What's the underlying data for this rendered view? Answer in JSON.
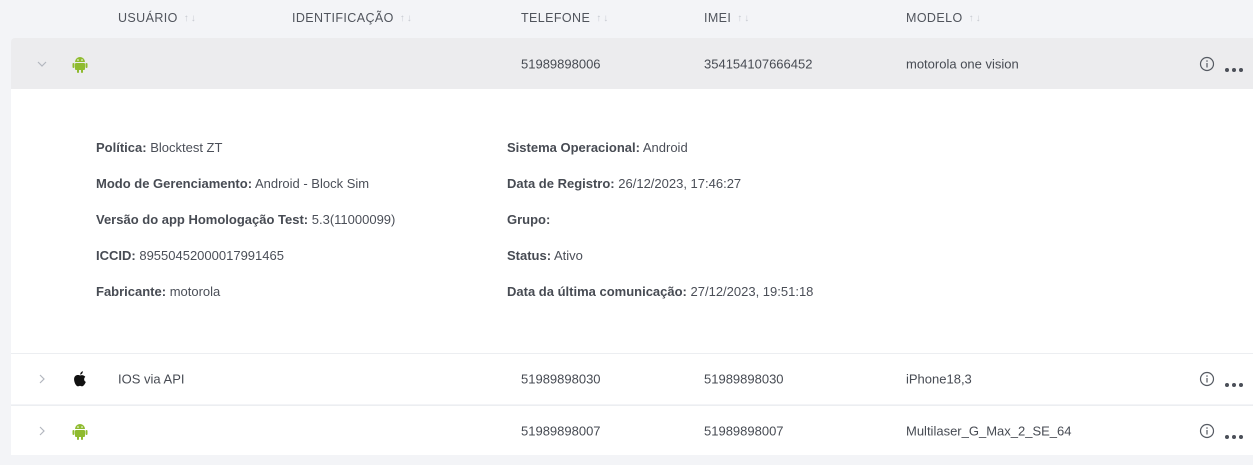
{
  "columns": [
    {
      "label": "USUÁRIO"
    },
    {
      "label": "IDENTIFICAÇÃO"
    },
    {
      "label": "TELEFONE"
    },
    {
      "label": "IMEI"
    },
    {
      "label": "MODELO"
    }
  ],
  "sort_arrows": "↑↓",
  "colors": {
    "android_green": "#8fbb2f",
    "apple_black": "#111111",
    "icon_grey": "#6c7078"
  },
  "rows": [
    {
      "os_icon": "android-icon",
      "identificacao": "",
      "telefone": "51989898006",
      "imei": "354154107666452",
      "modelo": "motorola one vision",
      "expanded": true
    },
    {
      "os_icon": "apple-icon",
      "identificacao": "IOS via API",
      "telefone": "51989898030",
      "imei": "51989898030",
      "modelo": "iPhone18,3",
      "expanded": false
    },
    {
      "os_icon": "android-icon",
      "identificacao": "",
      "telefone": "51989898007",
      "imei": "51989898007",
      "modelo": "Multilaser_G_Max_2_SE_64",
      "expanded": false
    }
  ],
  "details": {
    "left": [
      {
        "label": "Política:",
        "value": "Blocktest ZT"
      },
      {
        "label": "Modo de Gerenciamento:",
        "value": "Android - Block Sim"
      },
      {
        "label": "Versão do app Homologação Test:",
        "value": "5.3(11000099)"
      },
      {
        "label": "ICCID:",
        "value": "89550452000017991465"
      },
      {
        "label": "Fabricante:",
        "value": "motorola"
      }
    ],
    "right": [
      {
        "label": "Sistema Operacional:",
        "value": "Android"
      },
      {
        "label": "Data de Registro:",
        "value": "26/12/2023, 17:46:27"
      },
      {
        "label": "Grupo:",
        "value": ""
      },
      {
        "label": "Status:",
        "value": "Ativo"
      },
      {
        "label": "Data da última comunicação:",
        "value": "27/12/2023, 19:51:18"
      }
    ]
  }
}
